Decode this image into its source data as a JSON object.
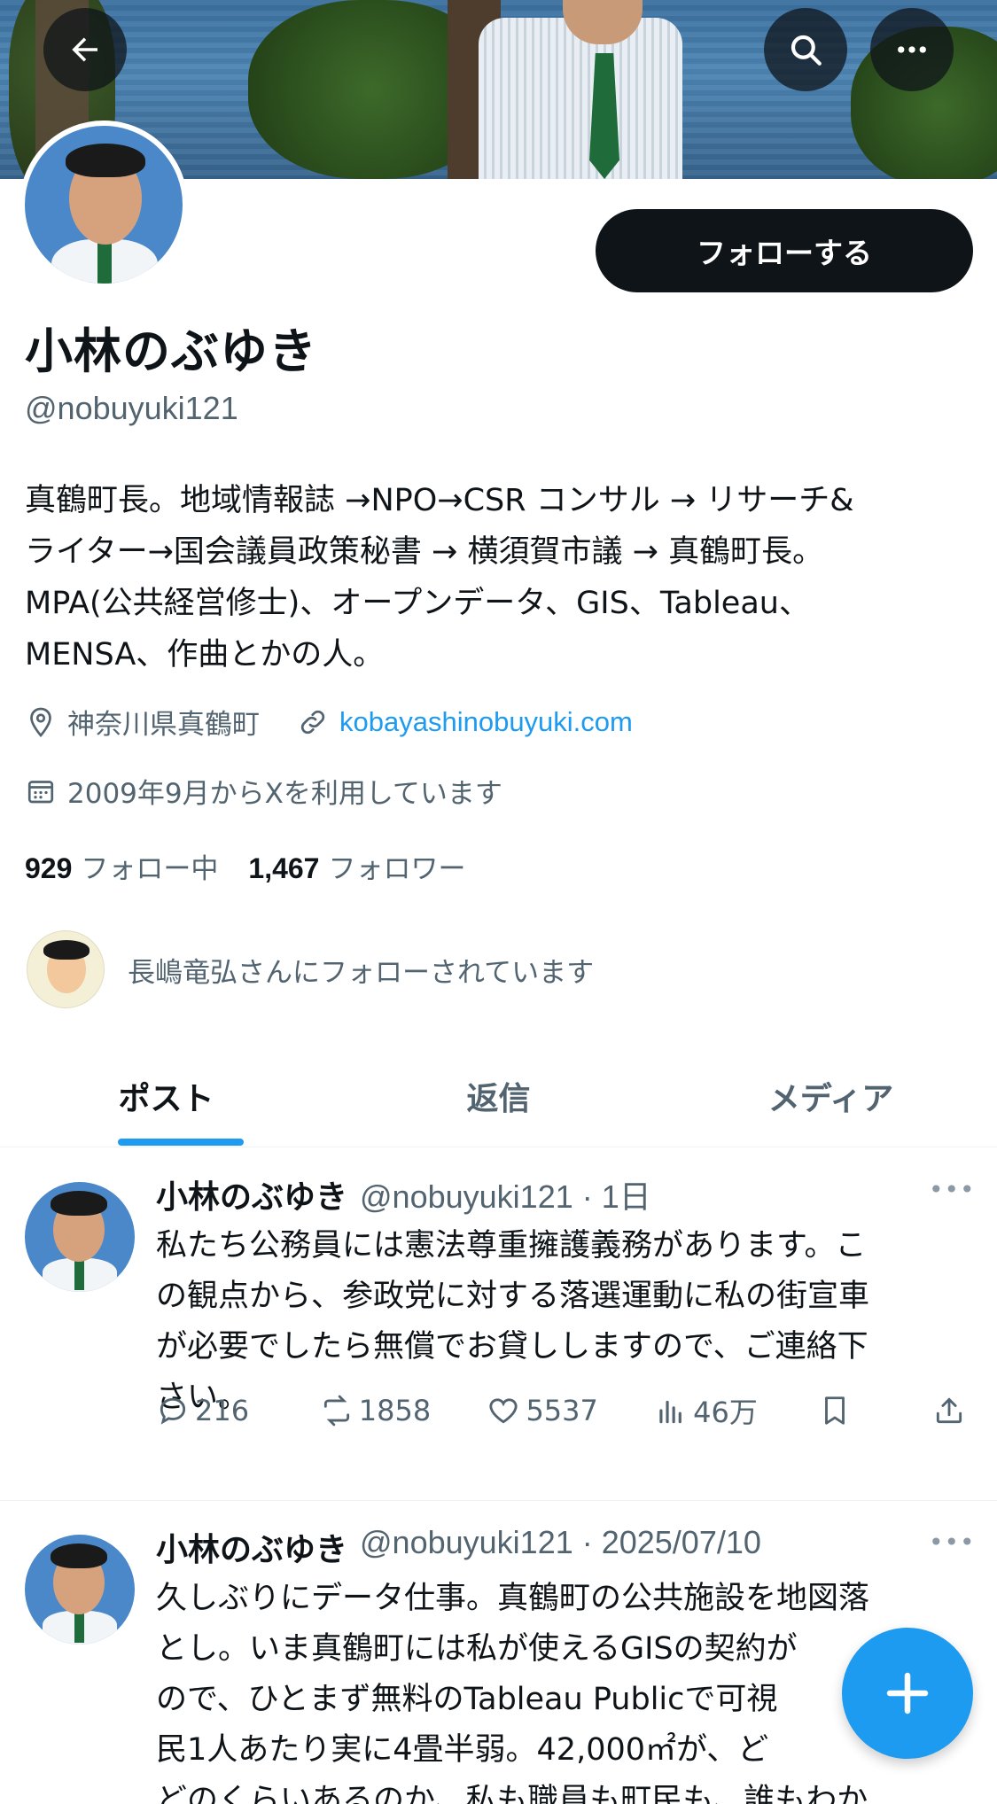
{
  "header": {
    "back_icon": "arrow-left-icon",
    "search_icon": "search-icon",
    "more_icon": "more-horizontal-icon"
  },
  "profile": {
    "follow_label": "フォローする",
    "name": "小林のぶゆき",
    "handle": "@nobuyuki121",
    "bio": "真鶴町長。地域情報誌 →NPO→CSR コンサル → リサーチ&\nライター→国会議員政策秘書 → 横須賀市議 → 真鶴町長。\nMPA(公共経営修士)、オープンデータ、GIS、Tableau、\nMENSA、作曲とかの人。",
    "location": "神奈川県真鶴町",
    "website": "kobayashinobuyuki.com",
    "joined": "2009年9月からXを利用しています",
    "following_count": "929",
    "following_label": "フォロー中",
    "followers_count": "1,467",
    "followers_label": "フォロワー",
    "followed_by": "長嶋竜弘さんにフォローされています"
  },
  "tabs": [
    {
      "label": "ポスト",
      "active": true
    },
    {
      "label": "返信",
      "active": false
    },
    {
      "label": "メディア",
      "active": false
    }
  ],
  "posts": [
    {
      "name": "小林のぶゆき",
      "meta": "@nobuyuki121 · 1日",
      "text": "私たち公務員には憲法尊重擁護義務があります。こ\nの観点から、参政党に対する落選運動に私の街宣車\nが必要でしたら無償でお貸ししますので、ご連絡下\nさい。",
      "replies": "216",
      "reposts": "1858",
      "likes": "5537",
      "views": "46万"
    },
    {
      "name": "小林のぶゆき",
      "meta": "@nobuyuki121 · 2025/07/10",
      "text": "久しぶりにデータ仕事。真鶴町の公共施設を地図落\nとし。いま真鶴町には私が使えるGISの契約が\nので、ひとまず無料のTableau Publicで可視\n民1人あたり実に4畳半弱。42,000㎡が、ど\nどのくらいあるのか、私も職員も町民も、誰もわか"
    }
  ],
  "colors": {
    "accent": "#1d9bf0",
    "text": "#0f1419",
    "secondary": "#536471"
  }
}
